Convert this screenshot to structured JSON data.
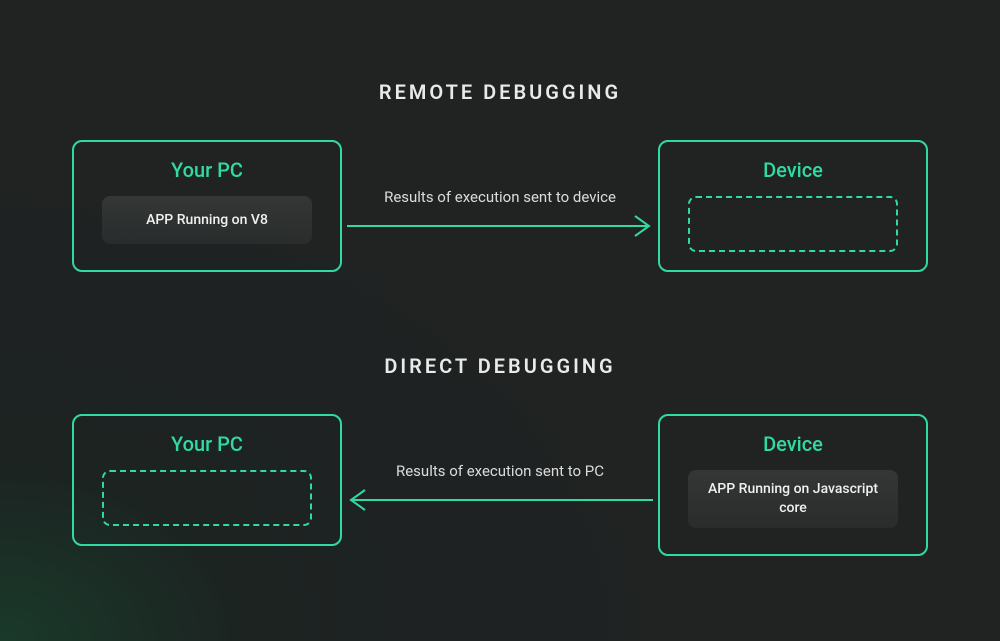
{
  "colors": {
    "accent": "#31d9a3",
    "text": "#e8e8e8",
    "bgDark": "#1e2222"
  },
  "sections": {
    "remote": {
      "title": "REMOTE DEBUGGING",
      "pc": {
        "title": "Your PC",
        "chip": "APP Running on V8"
      },
      "device": {
        "title": "Device"
      },
      "arrowLabel": "Results of execution sent to device",
      "arrowDirection": "right"
    },
    "direct": {
      "title": "DIRECT DEBUGGING",
      "pc": {
        "title": "Your PC"
      },
      "device": {
        "title": "Device",
        "chip": "APP Running on Javascript core"
      },
      "arrowLabel": "Results of execution sent to PC",
      "arrowDirection": "left"
    }
  }
}
